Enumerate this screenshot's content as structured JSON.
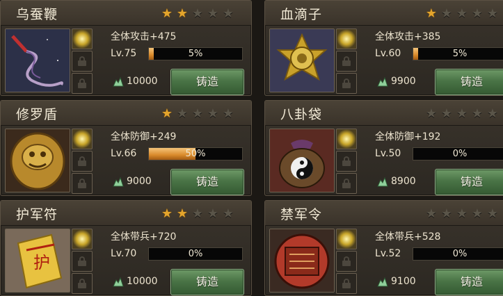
{
  "cards": [
    {
      "name": "乌蚕鞭",
      "stars_on": 2,
      "stars_total": 5,
      "stat": "全体攻击+475",
      "level": "Lv.75",
      "progress_pct": 5,
      "progress_label": "5%",
      "cost": "10000",
      "button": "铸造",
      "art_icon": "whip-icon"
    },
    {
      "name": "血滴子",
      "stars_on": 1,
      "stars_total": 5,
      "stat": "全体攻击+385",
      "level": "Lv.60",
      "progress_pct": 5,
      "progress_label": "5%",
      "cost": "9900",
      "button": "铸造",
      "art_icon": "flying-guillotine-icon"
    },
    {
      "name": "修罗盾",
      "stars_on": 1,
      "stars_total": 5,
      "stat": "全体防御+249",
      "level": "Lv.66",
      "progress_pct": 50,
      "progress_label": "50%",
      "cost": "9000",
      "button": "铸造",
      "art_icon": "shield-icon"
    },
    {
      "name": "八卦袋",
      "stars_on": 0,
      "stars_total": 5,
      "stat": "全体防御+192",
      "level": "Lv.50",
      "progress_pct": 0,
      "progress_label": "0%",
      "cost": "8900",
      "button": "铸造",
      "art_icon": "bagua-bag-icon"
    },
    {
      "name": "护军符",
      "stars_on": 2,
      "stars_total": 5,
      "stat": "全体带兵+720",
      "level": "Lv.70",
      "progress_pct": 0,
      "progress_label": "0%",
      "cost": "10000",
      "button": "铸造",
      "art_icon": "talisman-icon"
    },
    {
      "name": "禁军令",
      "stars_on": 0,
      "stars_total": 5,
      "stat": "全体带兵+528",
      "level": "Lv.52",
      "progress_pct": 0,
      "progress_label": "0%",
      "cost": "9100",
      "button": "铸造",
      "art_icon": "command-token-icon"
    }
  ],
  "colors": {
    "star_on": "#e4a52c",
    "star_off": "#5a5549",
    "button": "#4a7446",
    "bar_fill": "#d98a2b"
  }
}
